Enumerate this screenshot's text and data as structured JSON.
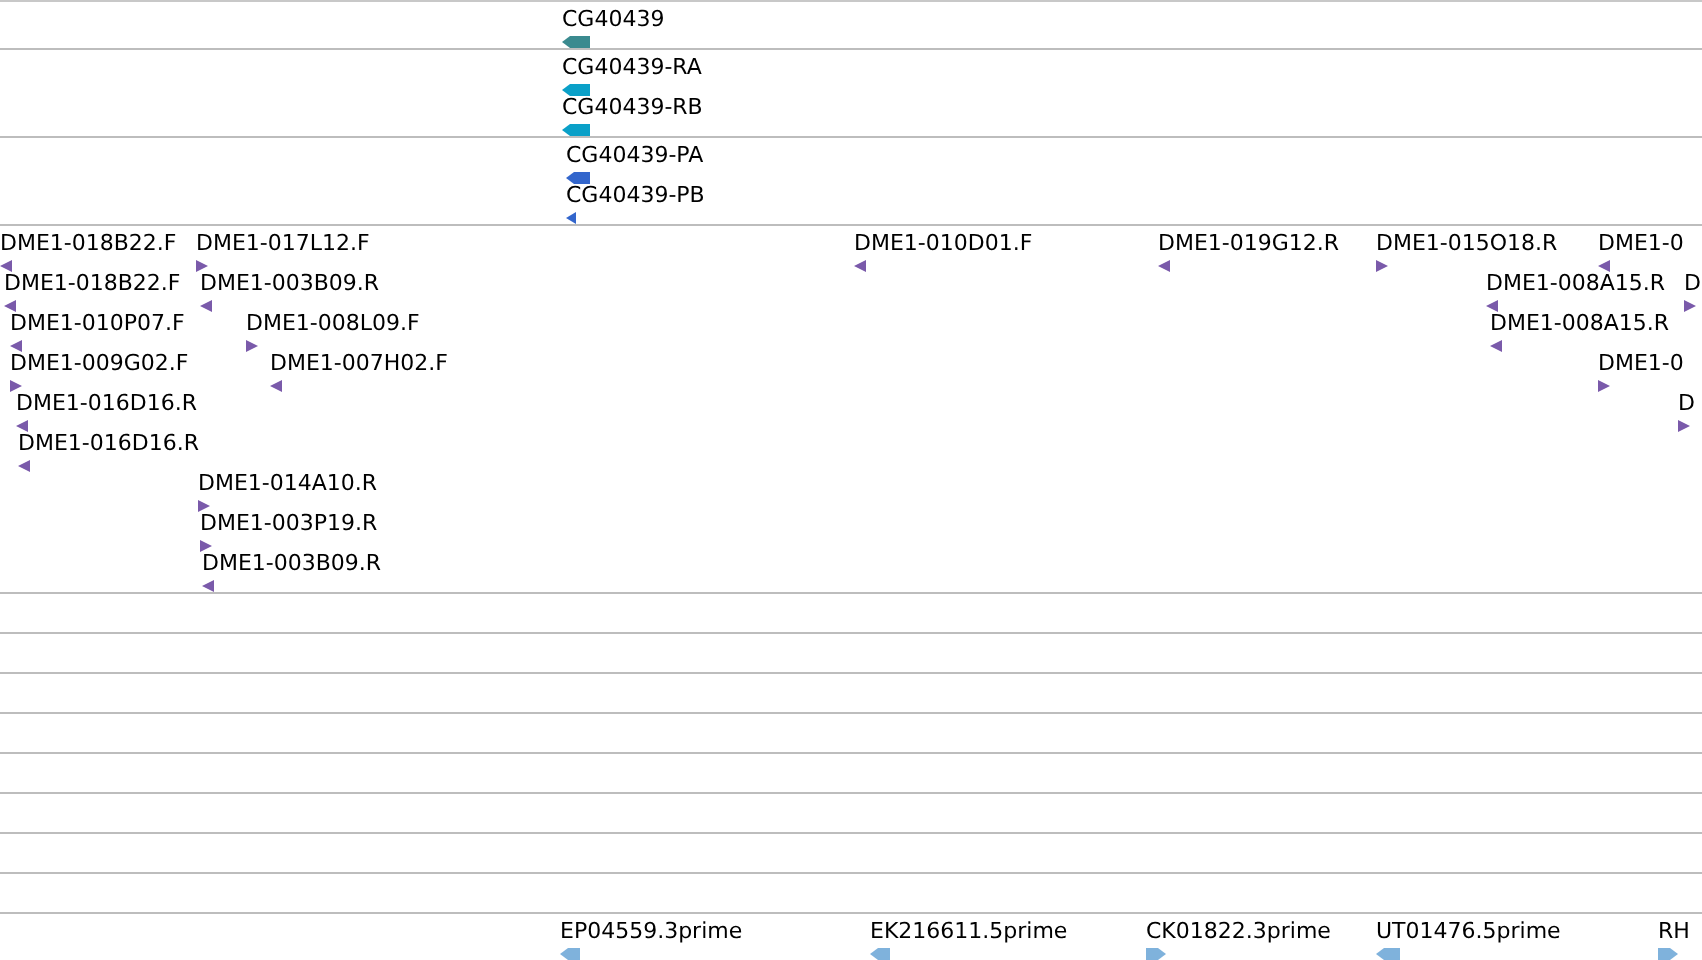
{
  "tracks": [
    {
      "kind": "gene",
      "color": "#3a8a8f",
      "features": [
        {
          "label": "CG40439",
          "reverse": true
        }
      ]
    },
    {
      "kind": "transcript",
      "color": "#0aa0c8",
      "features": [
        {
          "label": "CG40439-RA",
          "reverse": true
        },
        {
          "label": "CG40439-RB",
          "reverse": true
        }
      ]
    },
    {
      "kind": "protein",
      "color": "#3366cc",
      "features": [
        {
          "label": "CG40439-PA",
          "reverse": true
        },
        {
          "label": "CG40439-PB",
          "reverse": true
        }
      ]
    },
    {
      "kind": "clone-end",
      "color": "#7a5aaa",
      "features": [
        {
          "label": "DME1-018B22.F",
          "reverse": true
        },
        {
          "label": "DME1-017L12.F",
          "reverse": false
        },
        {
          "label": "DME1-010D01.F",
          "reverse": true
        },
        {
          "label": "DME1-019G12.R",
          "reverse": true
        },
        {
          "label": "DME1-015O18.R",
          "reverse": false
        },
        {
          "label": "DME1-0",
          "reverse": true
        },
        {
          "label": "DME1-018B22.F",
          "reverse": true
        },
        {
          "label": "DME1-003B09.R",
          "reverse": true
        },
        {
          "label": "DME1-008A15.R",
          "reverse": true
        },
        {
          "label": "D",
          "reverse": false
        },
        {
          "label": "DME1-010P07.F",
          "reverse": true
        },
        {
          "label": "DME1-008L09.F",
          "reverse": false
        },
        {
          "label": "DME1-008A15.R",
          "reverse": true
        },
        {
          "label": "DME1-009G02.F",
          "reverse": false
        },
        {
          "label": "DME1-007H02.F",
          "reverse": true
        },
        {
          "label": "DME1-0",
          "reverse": false
        },
        {
          "label": "DME1-016D16.R",
          "reverse": true
        },
        {
          "label": "D",
          "reverse": false
        },
        {
          "label": "DME1-016D16.R",
          "reverse": true
        },
        {
          "label": "DME1-014A10.R",
          "reverse": false
        },
        {
          "label": "DME1-003P19.R",
          "reverse": false
        },
        {
          "label": "DME1-003B09.R",
          "reverse": true
        }
      ]
    },
    {
      "kind": "est",
      "color": "#7fb2dc",
      "features": [
        {
          "label": "EP04559.3prime",
          "reverse": true
        },
        {
          "label": "EK216611.5prime",
          "reverse": true
        },
        {
          "label": "CK01822.3prime",
          "reverse": false
        },
        {
          "label": "UT01476.5prime",
          "reverse": true
        },
        {
          "label": "RH",
          "reverse": false
        }
      ]
    }
  ]
}
